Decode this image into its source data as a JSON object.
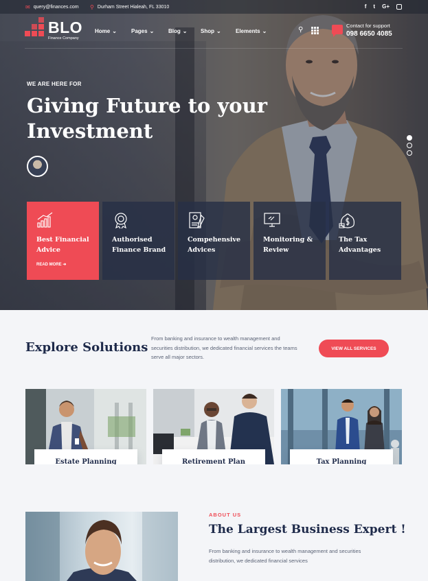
{
  "topbar": {
    "email": "query@finances.com",
    "address": "Durham Street Hialeah, FL 33010",
    "social": [
      "f",
      "t",
      "G+",
      "ig"
    ]
  },
  "brand": {
    "name": "BLO",
    "tagline": "Finance Company",
    "accent": "#ef4b55"
  },
  "menu": [
    {
      "label": "Home"
    },
    {
      "label": "Pages"
    },
    {
      "label": "Blog"
    },
    {
      "label": "Shop"
    },
    {
      "label": "Elements"
    }
  ],
  "support": {
    "label": "Contact for support",
    "phone": "098 6650 4085"
  },
  "hero": {
    "eyebrow": "WE ARE HERE FOR",
    "headline_line1": "Giving Future to your",
    "headline_line2": "Investment",
    "slide_count": 3,
    "active_slide": 1
  },
  "features": [
    {
      "title": "Best Financial Advice",
      "link": "READ MORE",
      "icon": "chart-icon",
      "active": true
    },
    {
      "title": "Authorised Finance Brand",
      "icon": "badge-icon"
    },
    {
      "title": "Compehensive Advices",
      "icon": "document-icon"
    },
    {
      "title": "Monitoring & Review",
      "icon": "monitor-icon"
    },
    {
      "title": "The Tax Advantages",
      "icon": "money-bag-icon"
    }
  ],
  "solutions": {
    "title": "Explore Solutions",
    "description": "From banking and insurance to wealth management and securities distribution, we dedicated financial services the teams serve all major sectors.",
    "button": "VIEW ALL SERVICES",
    "items": [
      {
        "label": "Estate Planning"
      },
      {
        "label": "Retirement Plan"
      },
      {
        "label": "Tax Planning"
      }
    ]
  },
  "about": {
    "eyebrow": "ABOUT US",
    "title": "The Largest Business Expert !",
    "description": "From banking and insurance to wealth management and securities distribution, we dedicated financial services"
  }
}
